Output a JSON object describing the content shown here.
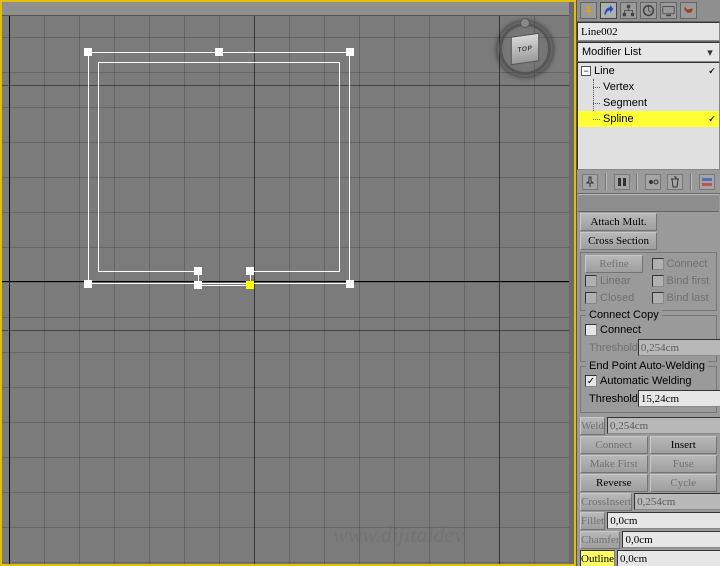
{
  "viewport": {
    "viewcube_face": "TOP",
    "watermark": "www.dijitaldev"
  },
  "object_name": "Line002",
  "modifier_dropdown": "Modifier List",
  "stack": {
    "root": "Line",
    "subs": [
      "Vertex",
      "Segment",
      "Spline"
    ],
    "selected_index": 2
  },
  "geometry": {
    "attach_mult": "Attach Mult.",
    "cross_section": "Cross Section",
    "refine": "Refine",
    "connect_ck": "Connect",
    "linear": "Linear",
    "bind_first": "Bind first",
    "closed": "Closed",
    "bind_last": "Bind last"
  },
  "connect_copy": {
    "title": "Connect Copy",
    "connect": "Connect",
    "threshold_label": "Threshold",
    "threshold_value": "0,254cm"
  },
  "auto_weld": {
    "title": "End Point Auto-Welding",
    "automatic": "Automatic Welding",
    "threshold_label": "Threshold",
    "threshold_value": "15,24cm"
  },
  "buttons": {
    "weld": {
      "label": "Weld",
      "val": "0,254cm"
    },
    "connect": "Connect",
    "insert": "Insert",
    "make_first": "Make First",
    "fuse": "Fuse",
    "reverse": "Reverse",
    "cycle": "Cycle",
    "crossinsert": {
      "label": "CrossInsert",
      "val": "0,254cm"
    },
    "fillet": {
      "label": "Fillet",
      "val": "0,0cm"
    },
    "chamfer": {
      "label": "Chamfer",
      "val": "0,0cm"
    },
    "outline": {
      "label": "Outline",
      "val": "0,0cm"
    }
  }
}
